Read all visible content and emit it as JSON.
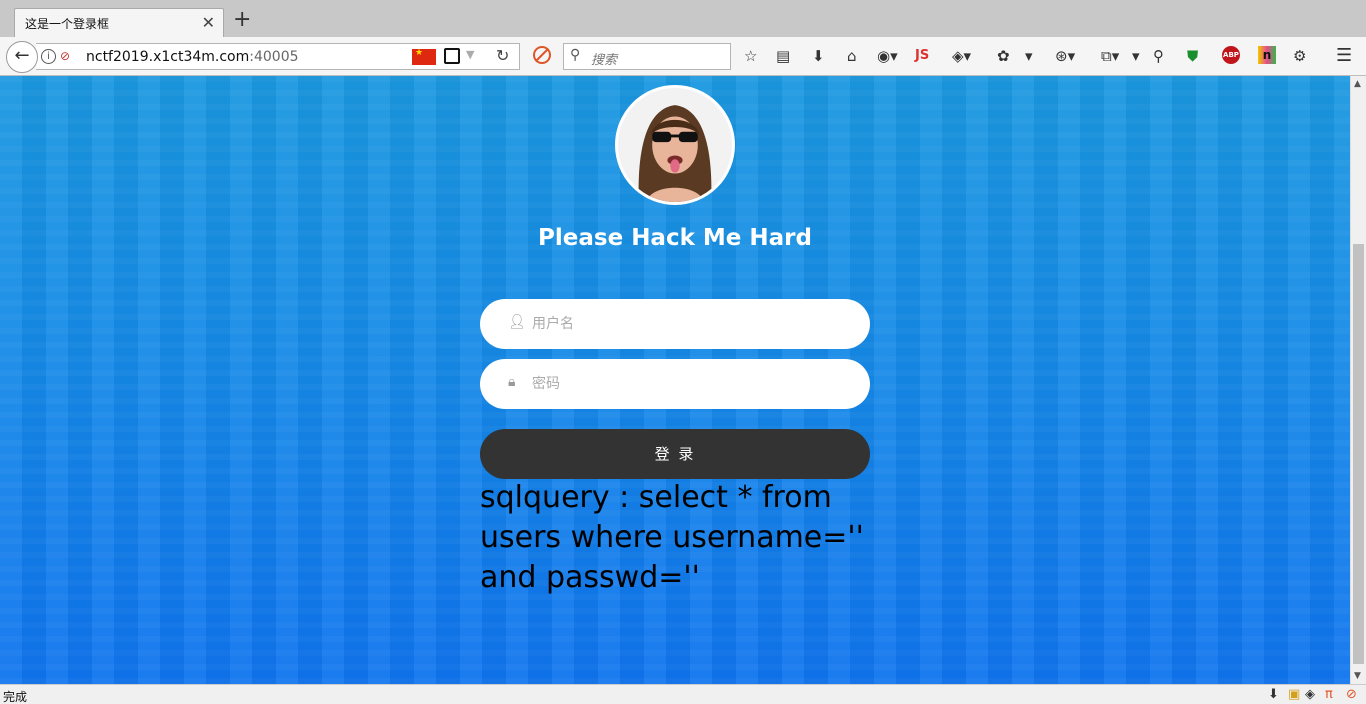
{
  "tab": {
    "title": "这是一个登录框"
  },
  "navbar": {
    "url_host": "nctf2019.x1ct34m.com",
    "url_port": ":40005",
    "search_placeholder": "搜索",
    "js_label": "JS",
    "abp_label": "ABP",
    "nn_label": "n"
  },
  "page": {
    "title": "Please Hack Me Hard",
    "username_placeholder": "用户名",
    "password_placeholder": "密码",
    "login_label": "登 录",
    "sql_text": "sqlquery : select * from users where username='' and passwd=''"
  },
  "status": {
    "text": "完成"
  },
  "colors": {
    "button": "#333333",
    "background": "#1588e8"
  }
}
